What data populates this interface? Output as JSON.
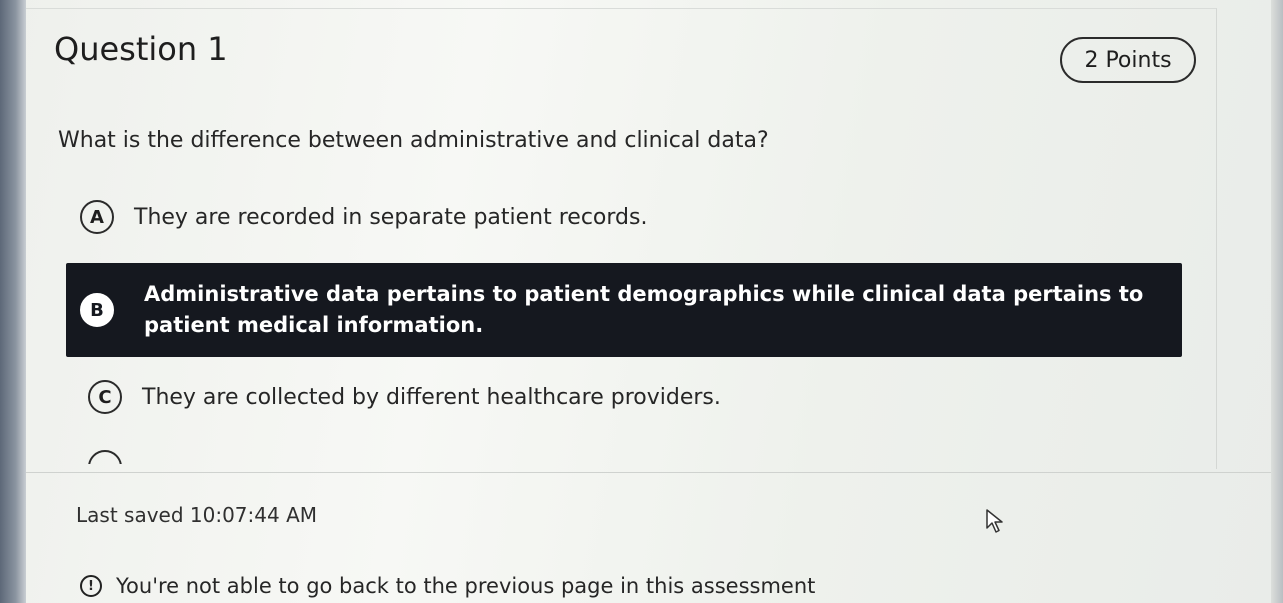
{
  "question": {
    "title": "Question 1",
    "points": "2 Points",
    "text": "What is the difference between administrative and clinical data?"
  },
  "options": [
    {
      "letter": "A",
      "text": "They are recorded in separate patient records.",
      "selected": false
    },
    {
      "letter": "B",
      "text": "Administrative data pertains to patient demographics while clinical data pertains to patient medical information.",
      "selected": true
    },
    {
      "letter": "C",
      "text": "They are collected by different healthcare providers.",
      "selected": false
    }
  ],
  "footer": {
    "last_saved": "Last saved 10:07:44 AM",
    "notice_icon": "!",
    "notice": "You're not able to go back to the previous page in this assessment"
  },
  "icons": {
    "notice": "exclamation-circle-icon",
    "cursor": "pointer-cursor-icon"
  },
  "colors": {
    "selected_bg": "#15181f",
    "selected_text": "#ffffff"
  }
}
